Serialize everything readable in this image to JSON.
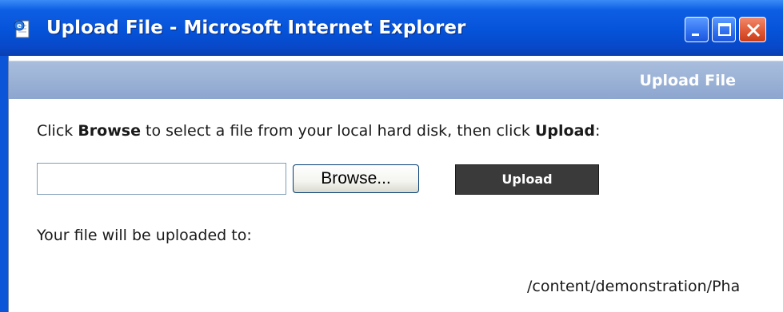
{
  "window": {
    "title": "Upload File - Microsoft Internet Explorer",
    "icon": "ie-page-icon",
    "controls": [
      "minimize-icon",
      "maximize-icon",
      "close-icon"
    ]
  },
  "header": {
    "title": "Upload File"
  },
  "instruction": {
    "part1": "Click ",
    "browse_word": "Browse",
    "part2": " to select a file from your local hard disk, then click ",
    "upload_word": "Upload",
    "part3": ":"
  },
  "file_input": {
    "value": ""
  },
  "buttons": {
    "browse_label": "Browse...",
    "upload_label": "Upload"
  },
  "destination": {
    "label": "Your file will be uploaded to:",
    "path": "/content/demonstration/Pha"
  },
  "colors": {
    "titlebar": "#0553d9",
    "header_bar": "#8da6cf",
    "upload_button": "#3a3a3a"
  }
}
